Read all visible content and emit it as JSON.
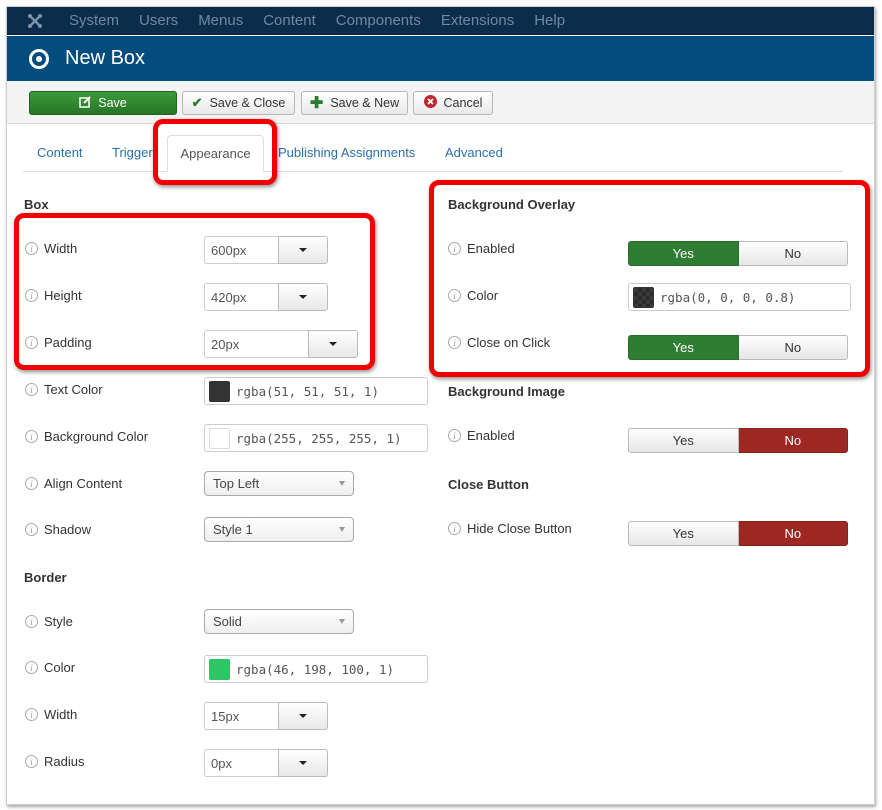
{
  "topnav": {
    "logo_icon": "joomla-logo-icon",
    "items": [
      "System",
      "Users",
      "Menus",
      "Content",
      "Components",
      "Extensions",
      "Help"
    ]
  },
  "titlebar": {
    "icon": "target-circle-icon",
    "title": "New Box"
  },
  "toolbar": {
    "save": {
      "label": "Save",
      "icon": "edit-icon"
    },
    "save_close": {
      "label": "Save & Close",
      "icon": "checkmark-icon"
    },
    "save_new": {
      "label": "Save & New",
      "icon": "plus-icon"
    },
    "cancel": {
      "label": "Cancel",
      "icon": "cancel-circle-icon"
    }
  },
  "tabs": {
    "items": [
      "Content",
      "Trigger",
      "Appearance",
      "Publishing Assignments",
      "Advanced"
    ],
    "active": "Appearance"
  },
  "box": {
    "title": "Box",
    "width": {
      "label": "Width",
      "value": "600px"
    },
    "height": {
      "label": "Height",
      "value": "420px"
    },
    "padding": {
      "label": "Padding",
      "value": "20px"
    },
    "text_color": {
      "label": "Text Color",
      "value": "rgba(51, 51, 51, 1)",
      "swatch": "#333333"
    },
    "background_color": {
      "label": "Background Color",
      "value": "rgba(255, 255, 255, 1)",
      "swatch": "#ffffff"
    },
    "align_content": {
      "label": "Align Content",
      "value": "Top Left"
    },
    "shadow": {
      "label": "Shadow",
      "value": "Style 1"
    }
  },
  "border": {
    "title": "Border",
    "style": {
      "label": "Style",
      "value": "Solid"
    },
    "color": {
      "label": "Color",
      "value": "rgba(46, 198, 100, 1)",
      "swatch": "#2ec664"
    },
    "width": {
      "label": "Width",
      "value": "15px"
    },
    "radius": {
      "label": "Radius",
      "value": "0px"
    }
  },
  "background_overlay": {
    "title": "Background Overlay",
    "enabled": {
      "label": "Enabled",
      "value": "Yes",
      "yes": "Yes",
      "no": "No"
    },
    "color": {
      "label": "Color",
      "value": "rgba(0, 0, 0, 0.8)",
      "swatch": "#333333"
    },
    "close_on_click": {
      "label": "Close on Click",
      "value": "Yes",
      "yes": "Yes",
      "no": "No"
    }
  },
  "background_image": {
    "title": "Background Image",
    "enabled": {
      "label": "Enabled",
      "value": "No",
      "yes": "Yes",
      "no": "No"
    }
  },
  "close_button": {
    "title": "Close Button",
    "hide": {
      "label": "Hide Close Button",
      "value": "No",
      "yes": "Yes",
      "no": "No"
    }
  },
  "colors": {
    "topnav_bg": "#0c2c4c",
    "titlebar_bg": "#034d7e",
    "save_green": "#2f8a2f",
    "toggle_yes": "#2f7d32",
    "toggle_no": "#9d2723",
    "highlight_red": "#f00000",
    "link_blue": "#2a6fa8"
  }
}
